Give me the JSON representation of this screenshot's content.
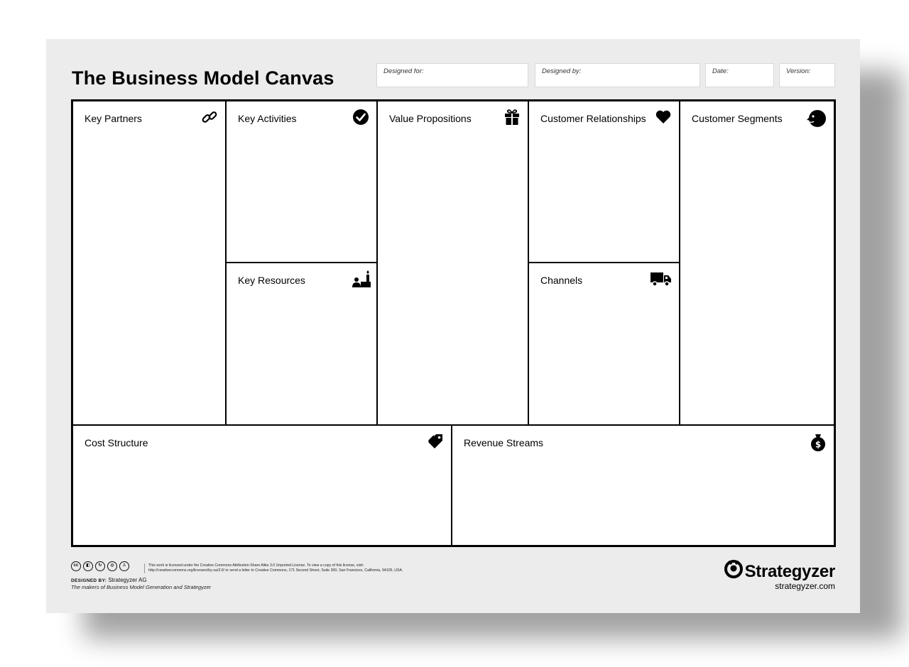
{
  "canvas": {
    "title": "The Business Model Canvas",
    "fields": [
      {
        "label": "Designed for:"
      },
      {
        "label": "Designed by:"
      },
      {
        "label": "Date:"
      },
      {
        "label": "Version:"
      }
    ],
    "blocks": {
      "key_partners": {
        "label": "Key Partners",
        "icon": "link-icon"
      },
      "key_activities": {
        "label": "Key Activities",
        "icon": "checkmark-icon"
      },
      "key_resources": {
        "label": "Key Resources",
        "icon": "factory-worker-icon"
      },
      "value_propositions": {
        "label": "Value Propositions",
        "icon": "gift-icon"
      },
      "customer_relationships": {
        "label": "Customer Relationships",
        "icon": "heart-icon"
      },
      "channels": {
        "label": "Channels",
        "icon": "truck-icon"
      },
      "customer_segments": {
        "label": "Customer Segments",
        "icon": "face-icon"
      },
      "cost_structure": {
        "label": "Cost Structure",
        "icon": "price-tag-icon"
      },
      "revenue_streams": {
        "label": "Revenue Streams",
        "icon": "money-bag-icon"
      }
    }
  },
  "footer": {
    "license_line1": "This work is licensed under the Creative Commons Attribution-Share Alike 3.0 Unported License. To view a copy of this license, visit:",
    "license_line2": "http://creativecommons.org/licenses/by-sa/3.0/ or send a letter to Creative Commons, 171 Second Street, Suite 300, San Francisco, California, 94105, USA.",
    "designed_by_label": "DESIGNED BY:",
    "designed_by_value": "Strategyzer AG",
    "makers": "The makers of Business Model Generation and Strategyzer",
    "brand_name": "Strategyzer",
    "brand_url": "strategyzer.com"
  },
  "colors": {
    "sheet": "#ececed",
    "ink": "#000000",
    "field": "#ffffff"
  }
}
